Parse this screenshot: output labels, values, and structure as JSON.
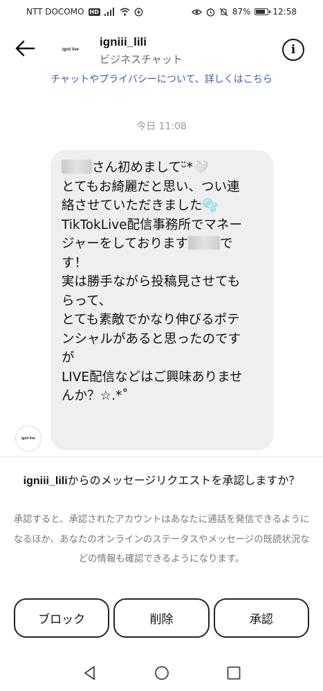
{
  "status_bar": {
    "carrier": "NTT DOCOMO",
    "hd": "HD",
    "battery_text": "87%",
    "battery_level": 0.87,
    "time": "12:58"
  },
  "header": {
    "avatar_text": "ignii live",
    "title": "igniii_lili",
    "subtitle": "ビジネスチャット",
    "info_label": "i"
  },
  "privacy_link": "チャットやプライバシーについて、詳しくはこちら",
  "timestamp": "今日 11:08",
  "message": {
    "lines": [
      "さん初めまして",
      "とてもお綺麗だと思い、つい連",
      "絡させていただきました🫧",
      "TikTokLive配信事務所でマネー",
      "ジャーをしております",
      "す！",
      "実は勝手ながら投稿見させても",
      "らって、",
      "とても素敵でかなり伸びるポテ",
      "ンシャルがあると思ったのです",
      "が",
      "LIVE配信などはご興味ありませ",
      "んか？☆.*˚"
    ],
    "line1_suffix": "ᵕ̈*🤍",
    "line5_suffix": "で",
    "sender_avatar_text": "ignii live"
  },
  "request": {
    "username": "igniii_lili",
    "question": "からのメッセージリクエストを承認しますか？",
    "description": "承認すると、承認されたアカウントはあなたに通話を発信できるようになるほか、あなたのオンラインのステータスやメッセージの既読状況などの情報も確認できるようになります。"
  },
  "actions": {
    "block": "ブロック",
    "delete": "削除",
    "accept": "承認"
  },
  "icons": {
    "back": "back-arrow-icon",
    "info": "info-icon",
    "nav_back": "triangle-back-icon",
    "nav_home": "circle-home-icon",
    "nav_recent": "square-recent-icon"
  }
}
